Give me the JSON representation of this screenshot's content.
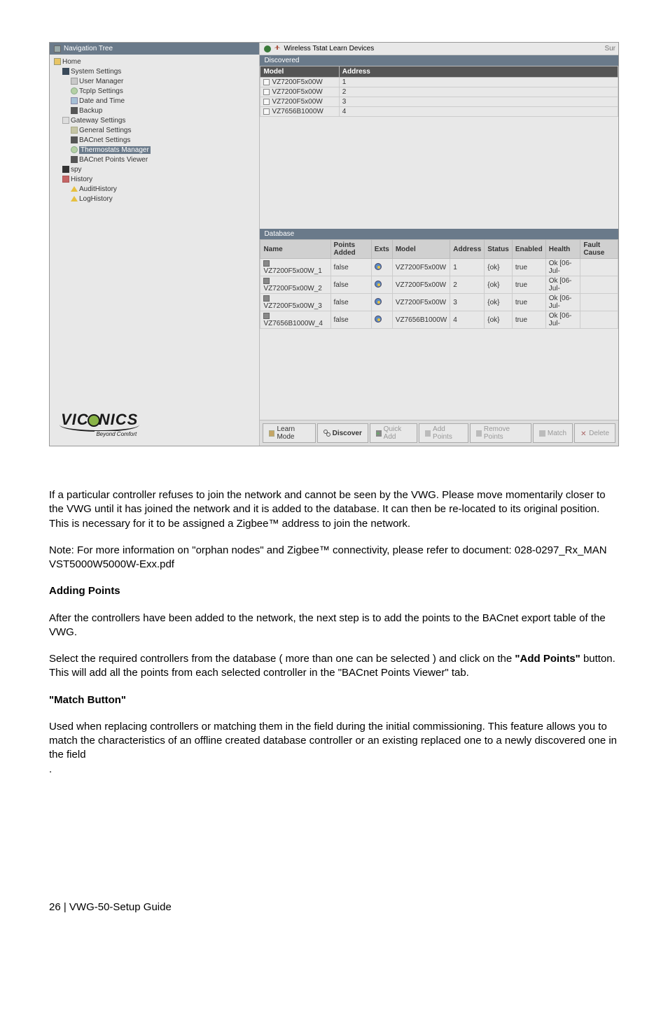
{
  "screenshot": {
    "nav_title": "Navigation Tree",
    "main_title": "Wireless Tstat Learn Devices",
    "main_sun": "Sur",
    "tree": {
      "home": "Home",
      "system_settings": "System Settings",
      "user_manager": "User Manager",
      "tcpip": "TcpIp Settings",
      "date_time": "Date and Time",
      "backup": "Backup",
      "gateway": "Gateway Settings",
      "general": "General Settings",
      "bacnet": "BACnet Settings",
      "tm": "Thermostats Manager",
      "pv": "BACnet Points Viewer",
      "spy": "spy",
      "history": "History",
      "audit": "AuditHistory",
      "log": "LogHistory"
    },
    "logo": {
      "text_pre": "VIC",
      "text_post": "NICS",
      "sub": "Beyond Comfort"
    },
    "discovered": {
      "title": "Discovered",
      "cols": {
        "model": "Model",
        "address": "Address"
      },
      "rows": [
        {
          "model": "VZ7200F5x00W",
          "address": "1"
        },
        {
          "model": "VZ7200F5x00W",
          "address": "2"
        },
        {
          "model": "VZ7200F5x00W",
          "address": "3"
        },
        {
          "model": "VZ7656B1000W",
          "address": "4"
        }
      ]
    },
    "database": {
      "title": "Database",
      "cols": {
        "name": "Name",
        "points_added": "Points Added",
        "exts": "Exts",
        "model": "Model",
        "address": "Address",
        "status": "Status",
        "enabled": "Enabled",
        "health": "Health",
        "fault": "Fault Cause"
      },
      "rows": [
        {
          "name": "VZ7200F5x00W_1",
          "points_added": "false",
          "model": "VZ7200F5x00W",
          "address": "1",
          "status": "{ok}",
          "enabled": "true",
          "health": "Ok [06-Jul-"
        },
        {
          "name": "VZ7200F5x00W_2",
          "points_added": "false",
          "model": "VZ7200F5x00W",
          "address": "2",
          "status": "{ok}",
          "enabled": "true",
          "health": "Ok [06-Jul-"
        },
        {
          "name": "VZ7200F5x00W_3",
          "points_added": "false",
          "model": "VZ7200F5x00W",
          "address": "3",
          "status": "{ok}",
          "enabled": "true",
          "health": "Ok [06-Jul-"
        },
        {
          "name": "VZ7656B1000W_4",
          "points_added": "false",
          "model": "VZ7656B1000W",
          "address": "4",
          "status": "{ok}",
          "enabled": "true",
          "health": "Ok [06-Jul-"
        }
      ]
    },
    "buttons": {
      "learn": "Learn Mode",
      "discover": "Discover",
      "quick_add": "Quick Add",
      "add_points": "Add Points",
      "remove_points": "Remove Points",
      "match": "Match",
      "delete": "Delete"
    }
  },
  "body": {
    "p1": "If a particular controller refuses to join the network and cannot be seen by the VWG. Please move momentarily closer to the VWG until it has joined the network and it is added to the database. It can then be re-located to its original position. This is necessary for it to be assigned a Zigbee™  address to join the network.",
    "p2": "Note: For more information on \"orphan nodes\" and Zigbee™  connectivity, please refer to document: 028-0297_Rx_MAN VST5000W5000W-Exx.pdf",
    "h1": "Adding Points",
    "p3": "After the controllers have been added to the network, the next step is to add the points to the BACnet export table of the VWG.",
    "p4a": "Select the required controllers from the database ( more than one can be selected ) and click on the ",
    "p4b": "\"Add Points\"",
    "p4c": " button. This will add all the points from each selected controller in the \"BACnet Points Viewer\" tab.",
    "h2": "\"Match Button\"",
    "p5": "Used when replacing controllers or matching them in the field during the initial commissioning. This feature allows you to match the characteristics of an offline created database controller or an existing replaced one to a newly discovered one in the field",
    "p5b": "."
  },
  "footer": "26 | VWG-50-Setup Guide"
}
